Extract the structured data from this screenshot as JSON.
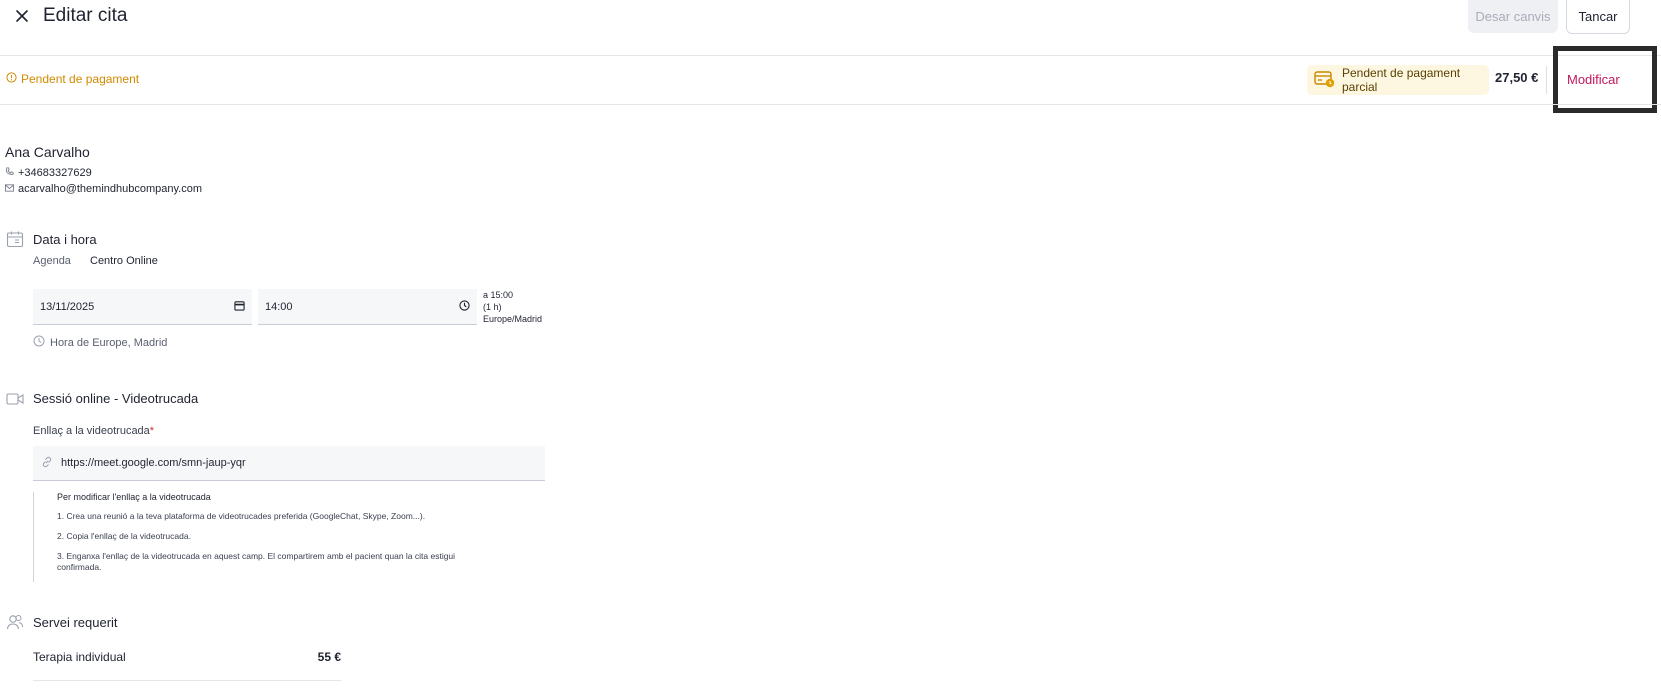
{
  "header": {
    "title": "Editar cita",
    "discard_label": "Desar canvis",
    "close_label": "Tancar"
  },
  "status": {
    "pending_label": "Pendent de pagament",
    "chip_label": "Pendent de pagament parcial",
    "amount": "27,50 €",
    "modify_label": "Modificar"
  },
  "patient": {
    "name": "Ana Carvalho",
    "phone": "+34683327629",
    "email": "acarvalho@themindhubcompany.com"
  },
  "datetime": {
    "section_title": "Data i hora",
    "agenda_label": "Agenda",
    "agenda_value": "Centro Online",
    "date_value": "13/11/2025",
    "time_value": "14:00",
    "end_time": "a 15:00",
    "duration": "(1 h)",
    "timezone": "Europe/Madrid",
    "tz_note": "Hora de Europe, Madrid"
  },
  "online": {
    "section_title": "Sessió online - Videotrucada",
    "link_label": "Enllaç a la videotrucada",
    "required_mark": "*",
    "link_value": "https://meet.google.com/smn-jaup-yqr",
    "help_title": "Per modificar l'enllaç a la videotrucada",
    "help_steps": [
      "1. Crea una reunió a la teva plataforma de videotrucades preferida (GoogleChat, Skype, Zoom...).",
      "2. Copia l'enllaç de la videotrucada.",
      "3. Enganxa l'enllaç de la videotrucada en aquest camp. El compartirem amb el pacient quan la cita estigui confirmada."
    ]
  },
  "service": {
    "section_title": "Servei requerit",
    "name": "Terapia individual",
    "price": "55 €"
  },
  "colors": {
    "accent": "#c2185b",
    "warning": "#d18a00",
    "chip_bg": "#fdf6e1"
  },
  "icons": [
    "close-icon",
    "warning-circle-icon",
    "payment-card-icon",
    "phone-icon",
    "mail-icon",
    "calendar-icon",
    "clock-icon",
    "video-icon",
    "link-icon",
    "users-icon"
  ]
}
